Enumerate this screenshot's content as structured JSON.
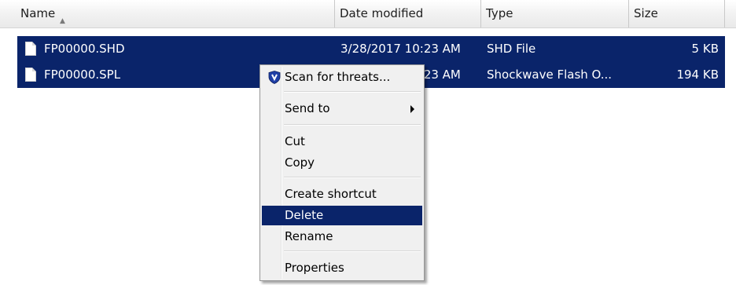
{
  "columns": {
    "name": "Name",
    "date_modified": "Date modified",
    "type": "Type",
    "size": "Size"
  },
  "files": [
    {
      "name": "FP00000.SHD",
      "date_modified": "3/28/2017 10:23 AM",
      "type": "SHD File",
      "size": "5 KB"
    },
    {
      "name": "FP00000.SPL",
      "date_modified": "3/28/2017 10:23 AM",
      "type": "Shockwave Flash O...",
      "size": "194 KB"
    }
  ],
  "context_menu": {
    "items": [
      {
        "label": "Scan for threats...",
        "icon": "shield-icon"
      },
      {
        "label": "Send to",
        "submenu": true
      },
      {
        "label": "Cut"
      },
      {
        "label": "Copy"
      },
      {
        "label": "Create shortcut"
      },
      {
        "label": "Delete",
        "highlighted": true
      },
      {
        "label": "Rename"
      },
      {
        "label": "Properties"
      }
    ]
  },
  "colors": {
    "selection": "#0a246a",
    "menu_bg": "#f0f0f0",
    "shield": "#1f3fa6"
  }
}
